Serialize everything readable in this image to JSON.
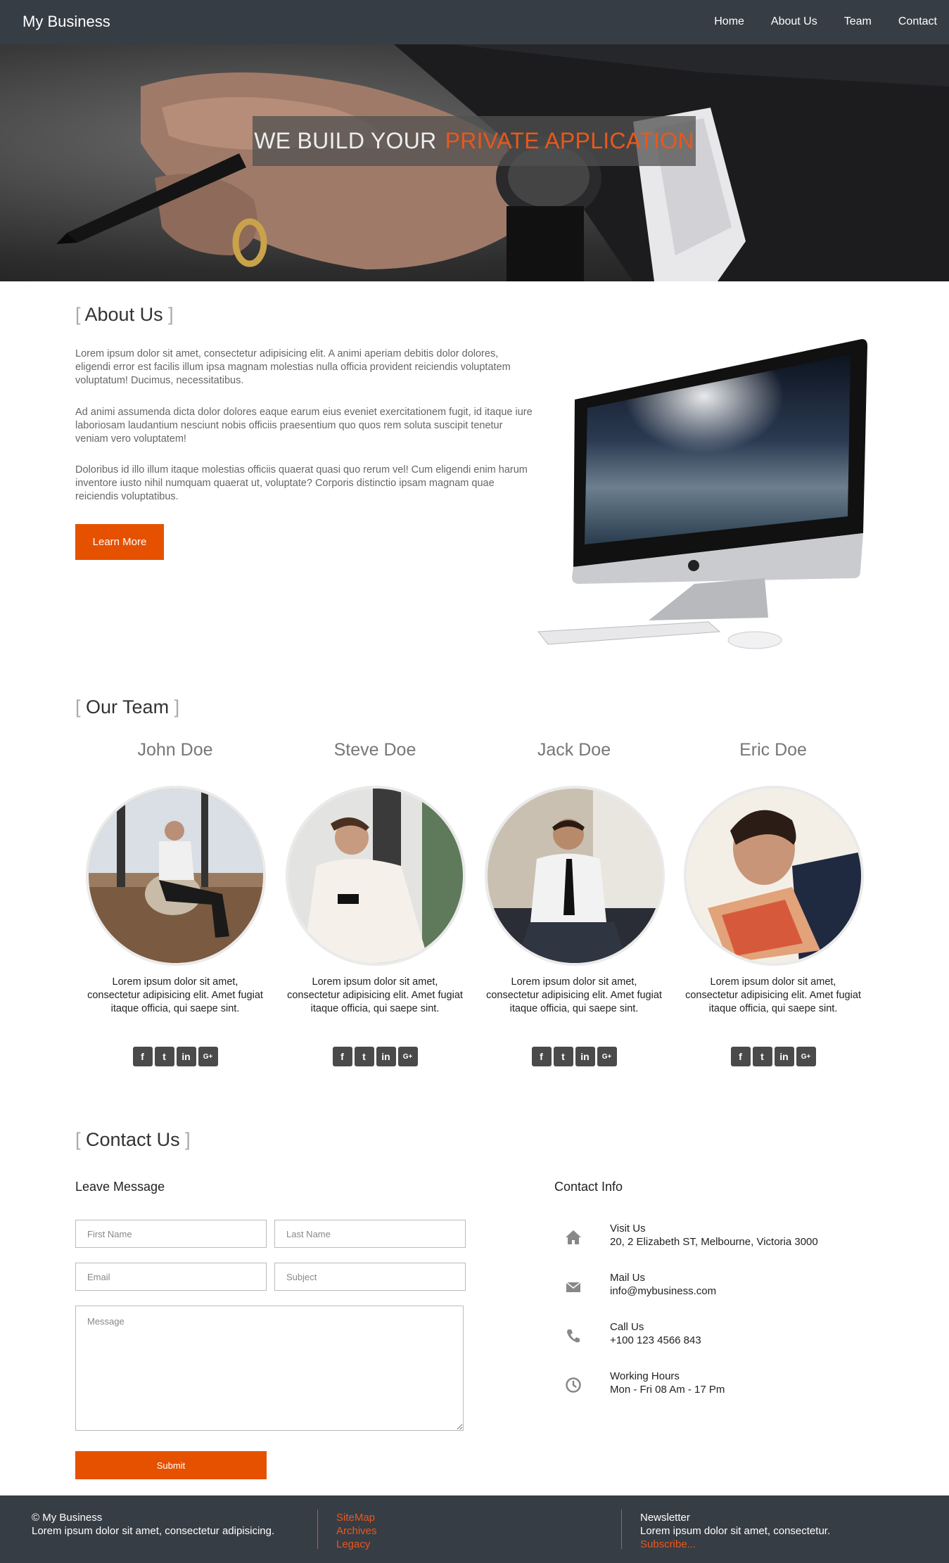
{
  "nav": {
    "brand": "My Business",
    "items": [
      "Home",
      "About Us",
      "Team",
      "Contact"
    ]
  },
  "hero": {
    "title_white": "WE BUILD YOUR",
    "title_orange": "PRIVATE APPLICATION"
  },
  "about": {
    "heading": "About Us",
    "paragraphs": [
      "Lorem ipsum dolor sit amet, consectetur adipisicing elit. A animi aperiam debitis dolor dolores, eligendi error est facilis illum ipsa magnam molestias nulla officia provident reiciendis voluptatem voluptatum! Ducimus, necessitatibus.",
      "Ad animi assumenda dicta dolor dolores eaque earum eius eveniet exercitationem fugit, id itaque iure laboriosam laudantium nesciunt nobis officiis praesentium quo quos rem soluta suscipit tenetur veniam vero voluptatem!",
      "Doloribus id illo illum itaque molestias officiis quaerat quasi quo rerum vel! Cum eligendi enim harum inventore iusto nihil numquam quaerat ut, voluptate? Corporis distinctio ipsam magnam quae reiciendis voluptatibus."
    ],
    "button": "Learn More"
  },
  "team": {
    "heading": "Our Team",
    "members": [
      {
        "name": "John Doe",
        "bio": "Lorem ipsum dolor sit amet, consectetur adipisicing elit. Amet fugiat itaque officia, qui saepe sint."
      },
      {
        "name": "Steve Doe",
        "bio": "Lorem ipsum dolor sit amet, consectetur adipisicing elit. Amet fugiat itaque officia, qui saepe sint."
      },
      {
        "name": "Jack Doe",
        "bio": "Lorem ipsum dolor sit amet, consectetur adipisicing elit. Amet fugiat itaque officia, qui saepe sint."
      },
      {
        "name": "Eric Doe",
        "bio": "Lorem ipsum dolor sit amet, consectetur adipisicing elit. Amet fugiat itaque officia, qui saepe sint."
      }
    ],
    "social_icons": [
      "facebook-icon",
      "twitter-icon",
      "linkedin-icon",
      "google-plus-icon"
    ]
  },
  "contact": {
    "heading": "Contact Us",
    "form_title": "Leave Message",
    "placeholders": {
      "first_name": "First Name",
      "last_name": "Last Name",
      "email": "Email",
      "subject": "Subject",
      "message": "Message"
    },
    "submit": "Submit",
    "info_title": "Contact Info",
    "info": [
      {
        "icon": "home-icon",
        "label": "Visit Us",
        "value": "20, 2 Elizabeth ST, Melbourne, Victoria 3000"
      },
      {
        "icon": "envelope-icon",
        "label": "Mail Us",
        "value": "info@mybusiness.com"
      },
      {
        "icon": "phone-icon",
        "label": "Call Us",
        "value": "+100 123 4566 843"
      },
      {
        "icon": "clock-icon",
        "label": "Working Hours",
        "value": "Mon - Fri 08 Am - 17 Pm"
      }
    ]
  },
  "footer": {
    "copyright": "© My Business",
    "tagline": "Lorem ipsum dolor sit amet, consectetur adipisicing.",
    "links": [
      "SiteMap",
      "Archives",
      "Legacy"
    ],
    "newsletter_title": "Newsletter",
    "newsletter_text": "Lorem ipsum dolor sit amet, consectetur.",
    "subscribe": "Subscribe..."
  },
  "colors": {
    "nav_bg": "#373d45",
    "accent": "#e65100",
    "text": "#555555"
  }
}
